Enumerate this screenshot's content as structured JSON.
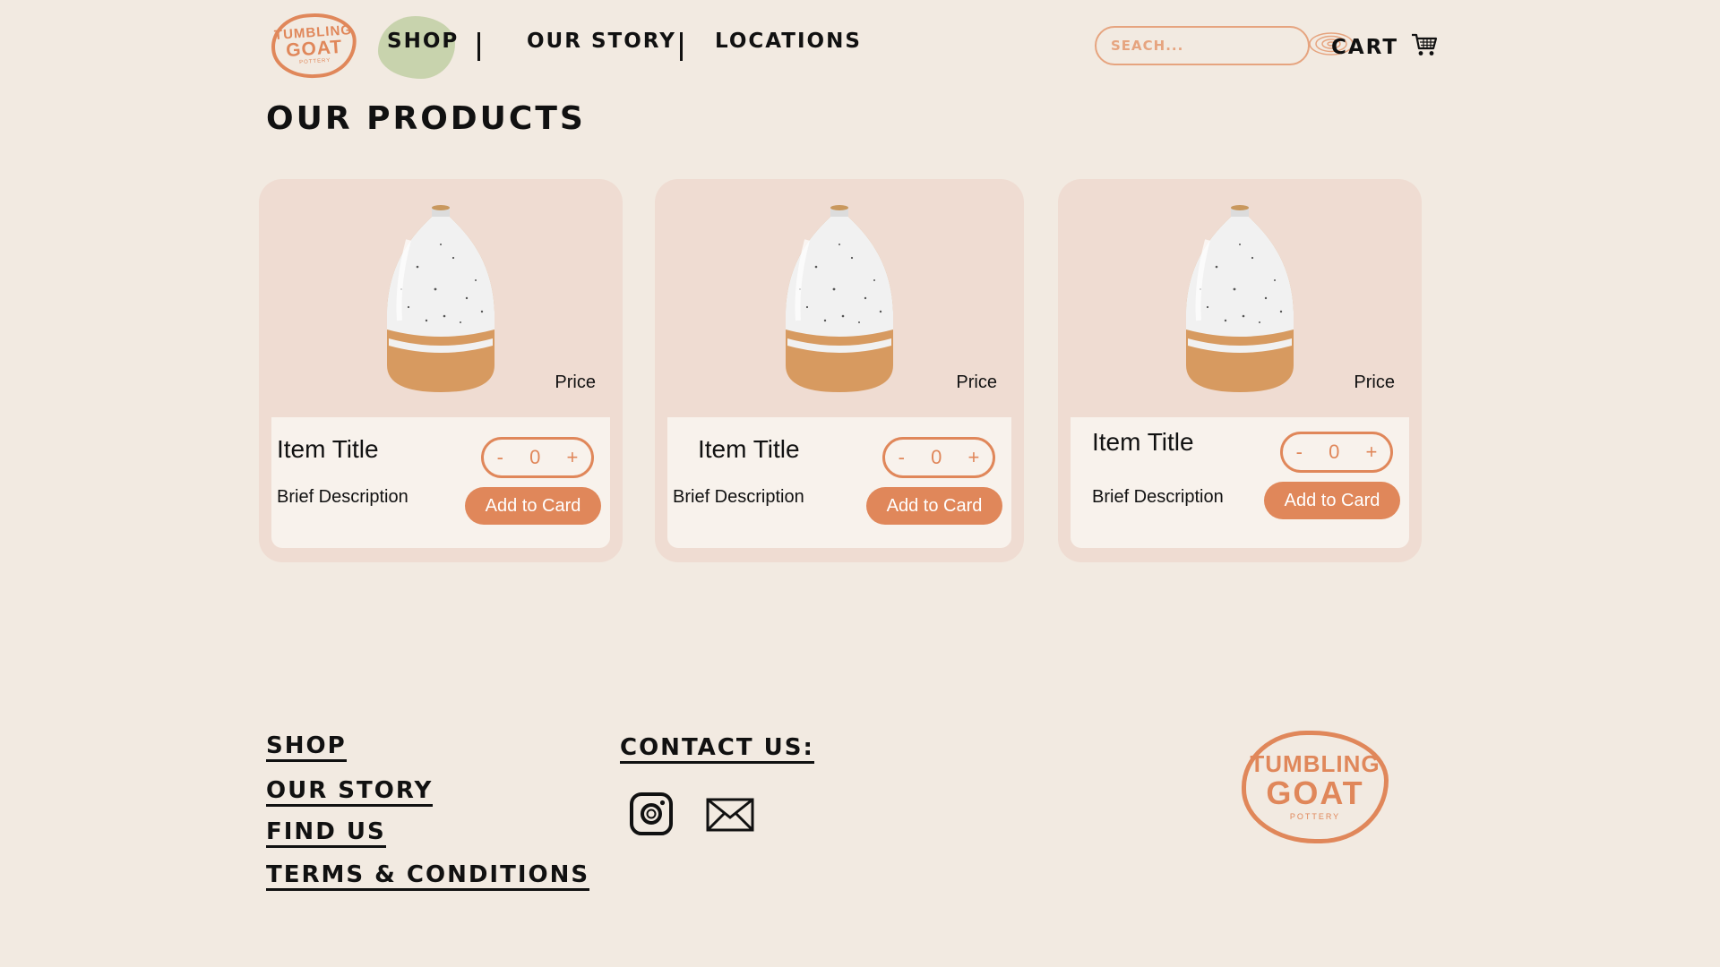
{
  "brand": {
    "line1": "TUMBLING",
    "line2": "GOAT",
    "line3": "POTTERY",
    "color": "#e0875a"
  },
  "nav": {
    "shop": "SHOP",
    "our_story": "OUR STORY",
    "locations": "LOCATIONS",
    "active_bg": "#c8d3ad"
  },
  "search": {
    "placeholder": "SEACH...",
    "icon": "spiral-icon"
  },
  "cart": {
    "label": "CART",
    "icon": "cart-icon"
  },
  "page": {
    "title": "OUR PRODUCTS"
  },
  "products": [
    {
      "title": "Item Title",
      "description": "Brief Description",
      "price": "Price",
      "quantity": "0",
      "minus": "-",
      "plus": "+",
      "button": "Add to Card"
    },
    {
      "title": "Item Title",
      "description": "Brief Description",
      "price": "Price",
      "quantity": "0",
      "minus": "-",
      "plus": "+",
      "button": "Add to Card"
    },
    {
      "title": "Item Title",
      "description": "Brief Description",
      "price": "Price",
      "quantity": "0",
      "minus": "-",
      "plus": "+",
      "button": "Add to Card"
    }
  ],
  "footer": {
    "links": [
      "SHOP",
      "OUR STORY",
      "FIND US",
      "TERMS & CONDITIONS"
    ],
    "contact_heading": "CONTACT US:",
    "social_icons": [
      "instagram-icon",
      "mail-icon"
    ]
  },
  "colors": {
    "background": "#f2eae1",
    "card": "#efdcd2",
    "accent": "#e0875a"
  }
}
